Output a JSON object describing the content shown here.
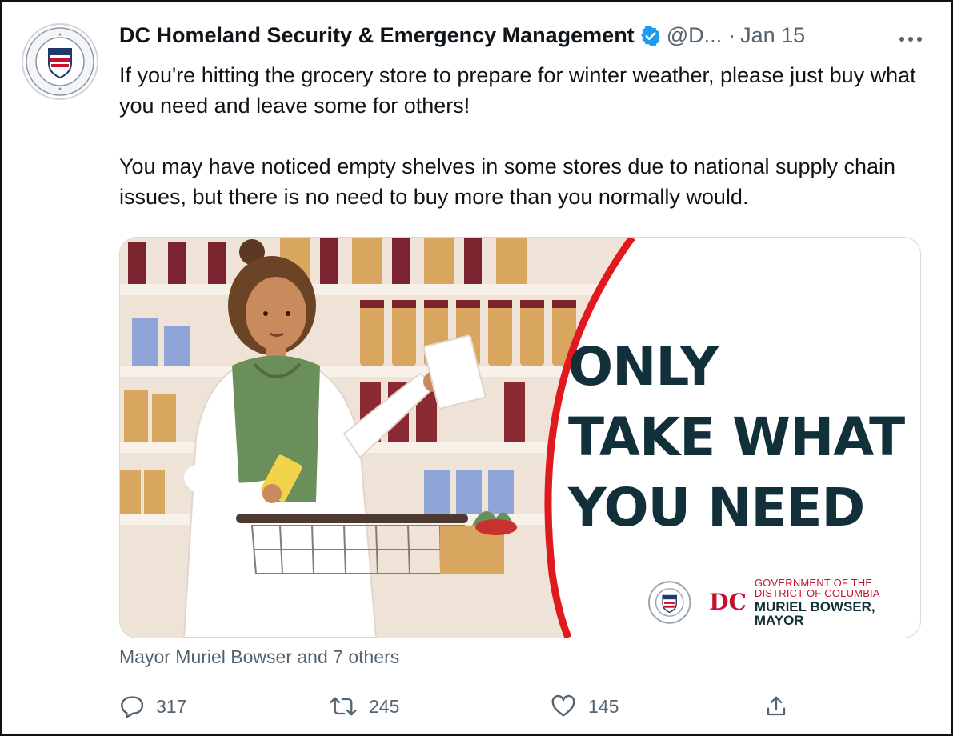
{
  "tweet": {
    "author_name": "DC Homeland Security & Emergency Management",
    "handle": "@D...",
    "separator": "·",
    "date": "Jan 15",
    "more_icon": "more-horizontal-icon",
    "verified_icon": "verified-badge-icon",
    "paragraphs": [
      "If you're hitting the grocery store to prepare for winter weather, please just buy what you need and leave some for others!",
      "You may have noticed empty shelves in some stores due to national supply chain issues, but there is no need to buy more than you normally would."
    ]
  },
  "media": {
    "headline_lines": [
      "ONLY",
      "TAKE WHAT",
      "YOU NEED"
    ],
    "gov_line1": "GOVERNMENT OF THE",
    "gov_line2": "DISTRICT OF COLUMBIA",
    "gov_line3": "MURIEL BOWSER, MAYOR",
    "dc_mark": "DC",
    "headline_color": "#12303a",
    "arc_color": "#e0191f"
  },
  "liked_by": "Mayor Muriel Bowser and 7 others",
  "actions": {
    "reply": {
      "icon": "reply-icon",
      "count": "317"
    },
    "retweet": {
      "icon": "retweet-icon",
      "count": "245"
    },
    "like": {
      "icon": "heart-icon",
      "count": "145"
    },
    "share": {
      "icon": "share-icon"
    }
  }
}
